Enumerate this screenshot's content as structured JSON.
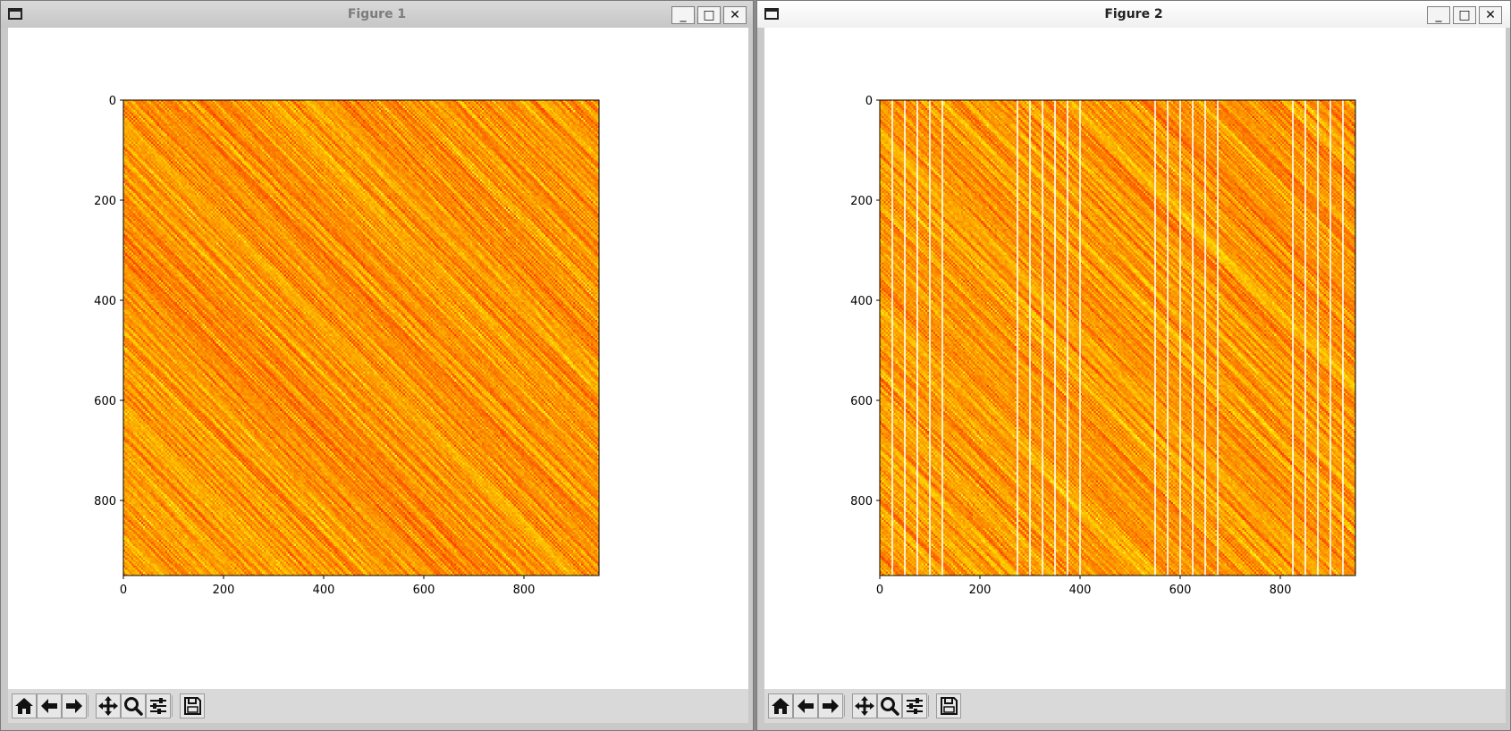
{
  "windows": [
    {
      "title": "Figure 1",
      "toolbar": [
        "home-icon",
        "back-arrow-icon",
        "forward-arrow-icon",
        "pan-move-icon",
        "zoom-magnifier-icon",
        "configure-subplots-icon",
        "save-floppy-icon"
      ]
    },
    {
      "title": "Figure 2",
      "toolbar": [
        "home-icon",
        "back-arrow-icon",
        "forward-arrow-icon",
        "pan-move-icon",
        "zoom-magnifier-icon",
        "configure-subplots-icon",
        "save-floppy-icon"
      ]
    }
  ],
  "window_buttons": {
    "minimize": "_",
    "maximize": "□",
    "close": "✕"
  },
  "chart_data": [
    {
      "type": "heatmap",
      "colormap": "autumn (red-orange-yellow)",
      "rows": 950,
      "cols": 950,
      "xlim": [
        0,
        950
      ],
      "ylim": [
        950,
        0
      ],
      "xticks": [
        0,
        200,
        400,
        600,
        800
      ],
      "yticks": [
        0,
        200,
        400,
        600,
        800
      ],
      "pattern": "dense diagonal streaks running top-left to bottom-right",
      "white_columns": []
    },
    {
      "type": "heatmap",
      "colormap": "autumn (red-orange-yellow)",
      "rows": 950,
      "cols": 950,
      "xlim": [
        0,
        950
      ],
      "ylim": [
        950,
        0
      ],
      "xticks": [
        0,
        200,
        400,
        600,
        800
      ],
      "yticks": [
        0,
        200,
        400,
        600,
        800
      ],
      "pattern": "dense diagonal streaks with thin white vertical lines",
      "white_columns": [
        25,
        50,
        75,
        100,
        125,
        275,
        300,
        325,
        350,
        375,
        400,
        550,
        575,
        600,
        625,
        650,
        675,
        825,
        850,
        875,
        900,
        925
      ]
    }
  ],
  "colors": {
    "red": "#e8251b",
    "orange": "#fb8f0d",
    "yellow": "#ffe81a",
    "white": "#ffffff"
  }
}
